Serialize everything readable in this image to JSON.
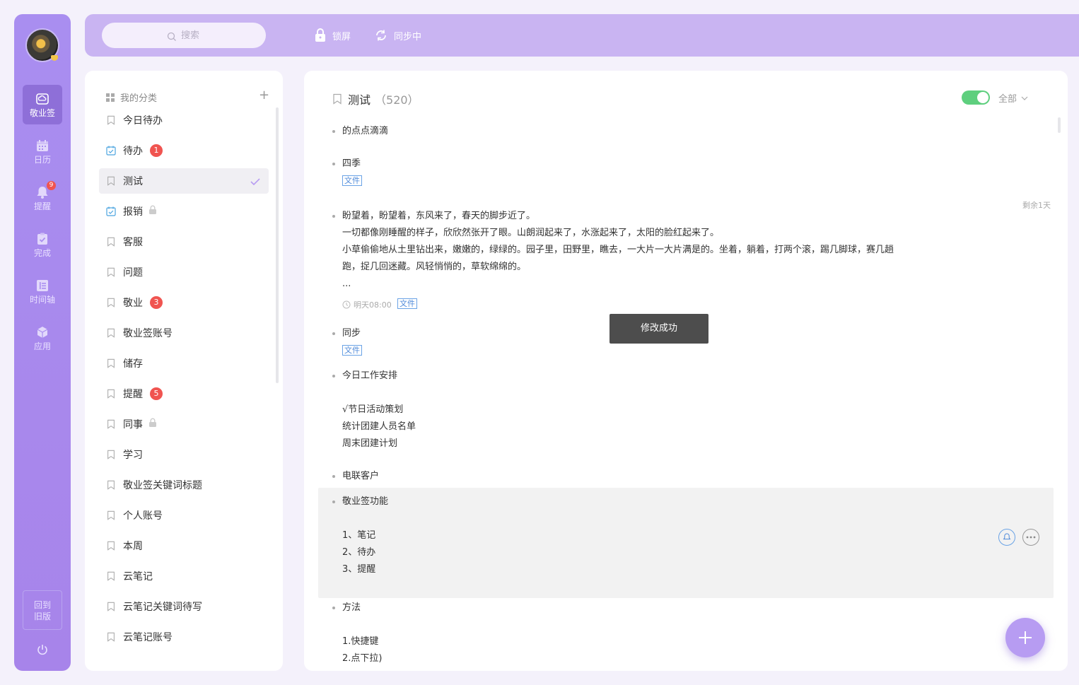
{
  "nav": {
    "items": [
      {
        "label": "敬业签",
        "icon": "cloud-note-icon",
        "active": true
      },
      {
        "label": "日历",
        "icon": "calendar-icon"
      },
      {
        "label": "提醒",
        "icon": "bell-icon",
        "badge": "9"
      },
      {
        "label": "完成",
        "icon": "clipboard-check-icon"
      },
      {
        "label": "时间轴",
        "icon": "timeline-icon"
      },
      {
        "label": "应用",
        "icon": "cube-icon"
      }
    ],
    "old_version_line1": "回到",
    "old_version_line2": "旧版"
  },
  "topbar": {
    "search_placeholder": "搜索",
    "lock_label": "锁屏",
    "sync_label": "同步中"
  },
  "categories": {
    "header": "我的分类",
    "items": [
      {
        "label": "今日待办",
        "icon": "bookmark-icon"
      },
      {
        "label": "待办",
        "icon": "calendar-check-icon",
        "badge": "1"
      },
      {
        "label": "测试",
        "icon": "bookmark-icon",
        "selected": true
      },
      {
        "label": "报销",
        "icon": "calendar-check-icon",
        "locked": true
      },
      {
        "label": "客服",
        "icon": "bookmark-icon"
      },
      {
        "label": "问题",
        "icon": "bookmark-icon"
      },
      {
        "label": "敬业",
        "icon": "bookmark-icon",
        "badge": "3"
      },
      {
        "label": "敬业签账号",
        "icon": "bookmark-icon"
      },
      {
        "label": "储存",
        "icon": "bookmark-icon"
      },
      {
        "label": "提醒",
        "icon": "bookmark-icon",
        "badge": "5"
      },
      {
        "label": "同事",
        "icon": "bookmark-icon",
        "locked": true
      },
      {
        "label": "学习",
        "icon": "bookmark-icon"
      },
      {
        "label": "敬业签关键词标题",
        "icon": "bookmark-icon"
      },
      {
        "label": "个人账号",
        "icon": "bookmark-icon"
      },
      {
        "label": "本周",
        "icon": "bookmark-icon"
      },
      {
        "label": "云笔记",
        "icon": "bookmark-icon"
      },
      {
        "label": "云笔记关键词待写",
        "icon": "bookmark-icon"
      },
      {
        "label": "云笔记账号",
        "icon": "bookmark-icon"
      }
    ]
  },
  "main": {
    "title": "测试",
    "count": "（520）",
    "filter_label": "全部",
    "toggle_on": true,
    "toast": "修改成功",
    "file_tag": "文件",
    "notes": [
      {
        "lines": [
          "的点点滴滴"
        ]
      },
      {
        "lines": [
          "四季"
        ],
        "file": true
      },
      {
        "lines": [
          "盼望着，盼望着，东风来了，春天的脚步近了。",
          "一切都像刚睡醒的样子，欣欣然张开了眼。山朗润起来了，水涨起来了，太阳的脸红起来了。",
          "小草偷偷地从土里钻出来，嫩嫩的，绿绿的。园子里，田野里，瞧去，一大片一大片满是的。坐着，躺着，打两个滚，踢几脚球，赛几趟",
          "跑，捉几回迷藏。风轻悄悄的，草软绵绵的。",
          "..."
        ],
        "remain": "剩余1天",
        "time": "明天08:00",
        "file": true
      },
      {
        "lines": [
          "同步"
        ],
        "file": true
      },
      {
        "lines": [
          "今日工作安排",
          "",
          "√节日活动策划",
          "统计团建人员名单",
          "周末团建计划"
        ]
      },
      {
        "lines": [
          "电联客户"
        ]
      },
      {
        "lines": [
          "敬业签功能",
          "",
          "1、笔记",
          "2、待办",
          "3、提醒"
        ],
        "highlighted": true
      },
      {
        "lines": [
          "方法",
          "",
          "1.快捷键",
          "2.点下拉)"
        ]
      }
    ]
  },
  "colors": {
    "nav_bg": "#a98ef0",
    "topbar_bg": "#c9b4f2",
    "badge": "#f05450",
    "toggle": "#5ecf7e",
    "file_tag": "#4f8ad9"
  }
}
